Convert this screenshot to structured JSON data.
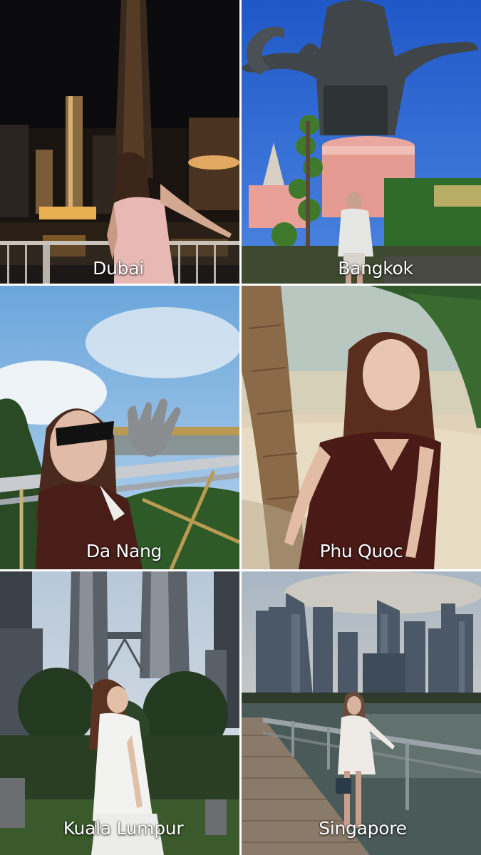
{
  "tiles": [
    {
      "label": "Dubai"
    },
    {
      "label": "Bangkok"
    },
    {
      "label": "Da Nang"
    },
    {
      "label": "Phu Quoc"
    },
    {
      "label": "Kuala Lumpur"
    },
    {
      "label": "Singapore"
    }
  ]
}
